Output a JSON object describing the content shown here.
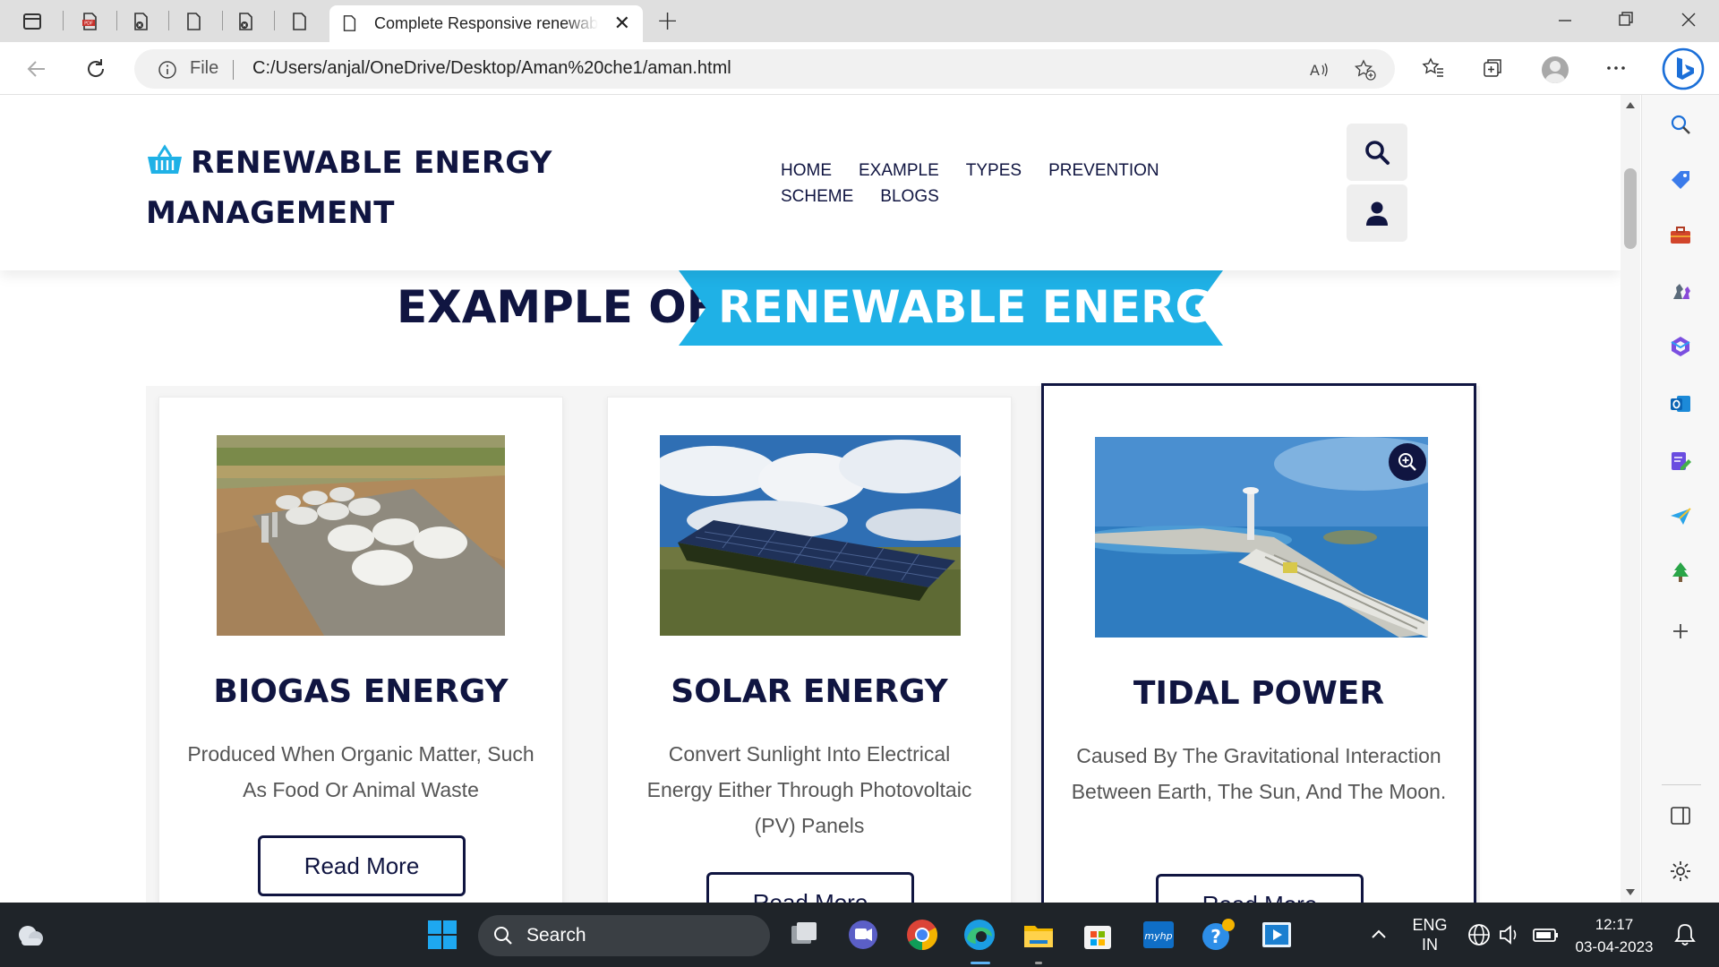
{
  "browser": {
    "active_tab_title": "Complete Responsive renewable energy",
    "url_scheme_label": "File",
    "url": "C:/Users/anjal/OneDrive/Desktop/Aman%20che1/aman.html",
    "new_tab_label": "+",
    "tab_close_glyph": "✕"
  },
  "site": {
    "logo_line1": "RENEWABLE ENERGY",
    "logo_line2": "MANAGEMENT",
    "nav": [
      "HOME",
      "EXAMPLE",
      "TYPES",
      "PREVENTION",
      "SCHEME",
      "BLOGS"
    ]
  },
  "heading": {
    "dark": "EXAMPLE OF",
    "highlight": "RENEWABLE ENERGY"
  },
  "cards": [
    {
      "title": "BIOGAS ENERGY",
      "description": "Produced When Organic Matter, Such As Food Or Animal Waste",
      "button": "Read More",
      "image": "biogas-plant-photo"
    },
    {
      "title": "SOLAR ENERGY",
      "description": "Convert Sunlight Into Electrical Energy Either Through Photovoltaic (PV) Panels",
      "button": "Read More",
      "image": "solar-panels-photo"
    },
    {
      "title": "TIDAL POWER",
      "description": "Caused By The Gravitational Interaction Between Earth, The Sun, And The Moon.",
      "button": "Read More",
      "image": "tidal-power-station-photo"
    }
  ],
  "taskbar": {
    "search_label": "Search",
    "lang_line1": "ENG",
    "lang_line2": "IN",
    "time": "12:17",
    "date": "03-04-2023",
    "notify_glyph": "^"
  },
  "colors": {
    "brand_dark": "#101541",
    "accent_blue": "#1fb1e6",
    "page_bg": "#ffffff"
  }
}
